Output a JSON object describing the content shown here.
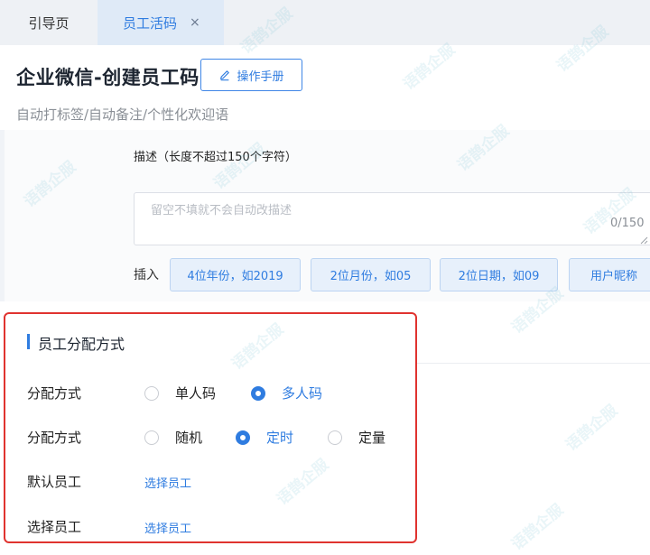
{
  "tabs": [
    {
      "label": "引导页"
    },
    {
      "label": "员工活码",
      "close": "×"
    }
  ],
  "header": {
    "title": "企业微信-创建员工码",
    "manual_button": "操作手册",
    "subtitle": "自动打标签/自动备注/个性化欢迎语"
  },
  "description": {
    "label": "描述（长度不超过150个字符）",
    "placeholder": "留空不填就不会自动改描述",
    "value": "",
    "counter": "0/150"
  },
  "insert": {
    "label": "插入",
    "buttons": [
      "4位年份，如2019",
      "2位月份，如05",
      "2位日期，如09",
      "用户昵称"
    ]
  },
  "allocation": {
    "title": "员工分配方式",
    "rows": [
      {
        "label": "分配方式",
        "options": [
          {
            "label": "单人码",
            "checked": false
          },
          {
            "label": "多人码",
            "checked": true
          }
        ]
      },
      {
        "label": "分配方式",
        "options": [
          {
            "label": "随机",
            "checked": false
          },
          {
            "label": "定时",
            "checked": true
          },
          {
            "label": "定量",
            "checked": false
          }
        ]
      },
      {
        "label": "默认员工",
        "link": "选择员工"
      },
      {
        "label": "选择员工",
        "link": "选择员工"
      }
    ]
  },
  "watermark": "语鹊企服",
  "colors": {
    "accent": "#2f7ce0",
    "highlight_border": "#e0332f",
    "active_tab_bg": "#dfeaf7"
  },
  "icons": {
    "manual_button": "pencil-icon"
  }
}
